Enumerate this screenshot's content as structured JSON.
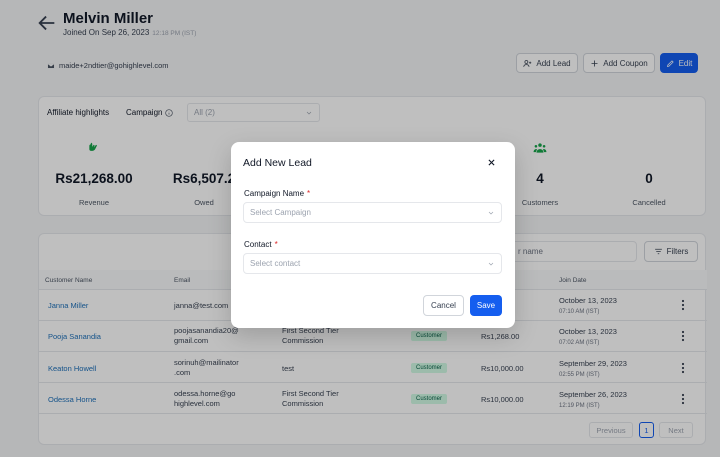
{
  "header": {
    "name": "Melvin Miller",
    "joined": "Joined On Sep 26, 2023",
    "joined_time": "12:18 PM (IST)",
    "email": "maide+2ndtier@gohighlevel.com",
    "buttons": {
      "add_lead": "Add Lead",
      "add_coupon": "Add Coupon",
      "edit": "Edit"
    }
  },
  "highlights": {
    "title": "Affiliate highlights",
    "campaign_label": "Campaign",
    "campaign_select": "All (2)",
    "stats": [
      {
        "value": "Rs21,268.00",
        "label": "Revenue",
        "icon": "hand-coins-icon",
        "color": "#16a34a"
      },
      {
        "value": "Rs6,507.2",
        "label": "Owed"
      },
      {
        "value": "4",
        "label": "Customers",
        "icon": "users-icon",
        "color": "#16a34a"
      },
      {
        "value": "0",
        "label": "Cancelled"
      }
    ]
  },
  "table": {
    "search_placeholder": "r name",
    "filters_label": "Filters",
    "columns": [
      "Customer Name",
      "Email",
      "Join Date"
    ],
    "rows": [
      {
        "name": "Janna Miller",
        "email": "janna@test.com",
        "campaign": "",
        "status": "",
        "amount": "",
        "date": "October 13, 2023",
        "time": "07:10 AM (IST)"
      },
      {
        "name": "Pooja Sanandia",
        "email": "poojasanandia20@gmail.com",
        "email_l1": "poojasanandia20@",
        "email_l2": "gmail.com",
        "campaign_l1": "First Second Tier",
        "campaign_l2": "Commission",
        "status": "Customer",
        "amount": "Rs1,268.00",
        "date": "October 13, 2023",
        "time": "07:02 AM (IST)"
      },
      {
        "name": "Keaton Howell",
        "email_l1": "sorinuh@mailinator",
        "email_l2": ".com",
        "campaign_l1": "test",
        "campaign_l2": "",
        "status": "Customer",
        "amount": "Rs10,000.00",
        "date": "September 29, 2023",
        "time": "02:55 PM (IST)"
      },
      {
        "name": "Odessa Horne",
        "email_l1": "odessa.horne@go",
        "email_l2": "highlevel.com",
        "campaign_l1": "First Second Tier",
        "campaign_l2": "Commission",
        "status": "Customer",
        "amount": "Rs10,000.00",
        "date": "September 26, 2023",
        "time": "12:19 PM (IST)"
      }
    ],
    "pager": {
      "prev": "Previous",
      "page": "1",
      "next": "Next"
    }
  },
  "modal": {
    "title": "Add New Lead",
    "campaign_label": "Campaign Name",
    "campaign_placeholder": "Select Campaign",
    "contact_label": "Contact",
    "contact_placeholder": "Select contact",
    "required_mark": "*",
    "cancel": "Cancel",
    "save": "Save"
  }
}
